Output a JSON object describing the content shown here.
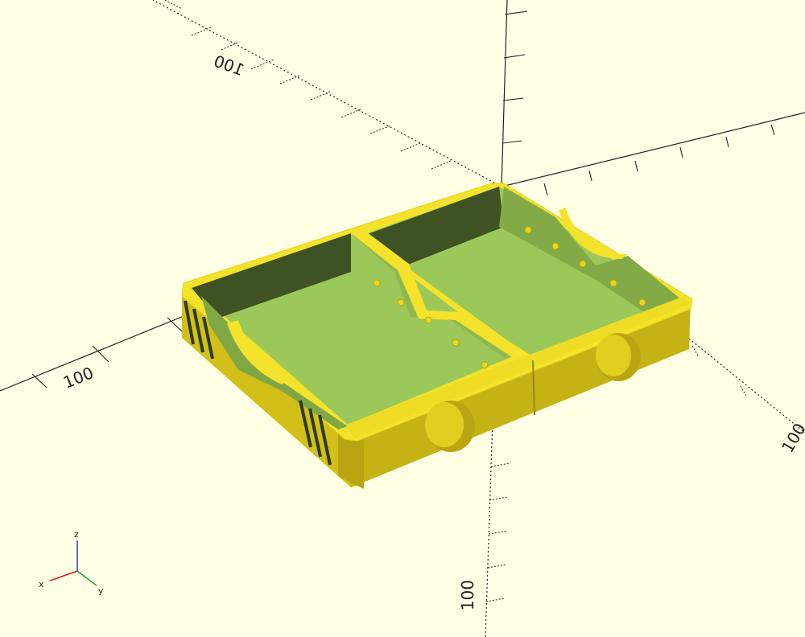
{
  "app": {
    "view": "3D viewport"
  },
  "colors": {
    "background": "#ffffe5",
    "axis": "#222222",
    "model_top": "#f2e22a",
    "model_side": "#d8c51c",
    "model_dark": "#c9b514",
    "interior_floor": "#9dc85a",
    "interior_wall": "#7fa845",
    "interior_wall_dark": "#3f5226",
    "axis_x": "#e0141e",
    "axis_y": "#1aa82a",
    "axis_z": "#2438d8"
  },
  "scale_labels": {
    "neg_x": "100",
    "pos_y_far": "100",
    "neg_y_near": "100",
    "neg_z": "100"
  },
  "axes_gizmo": {
    "x_label": "x",
    "y_label": "y",
    "z_label": "z"
  },
  "icons": {
    "axes_gizmo": "xyz-axes-icon"
  }
}
